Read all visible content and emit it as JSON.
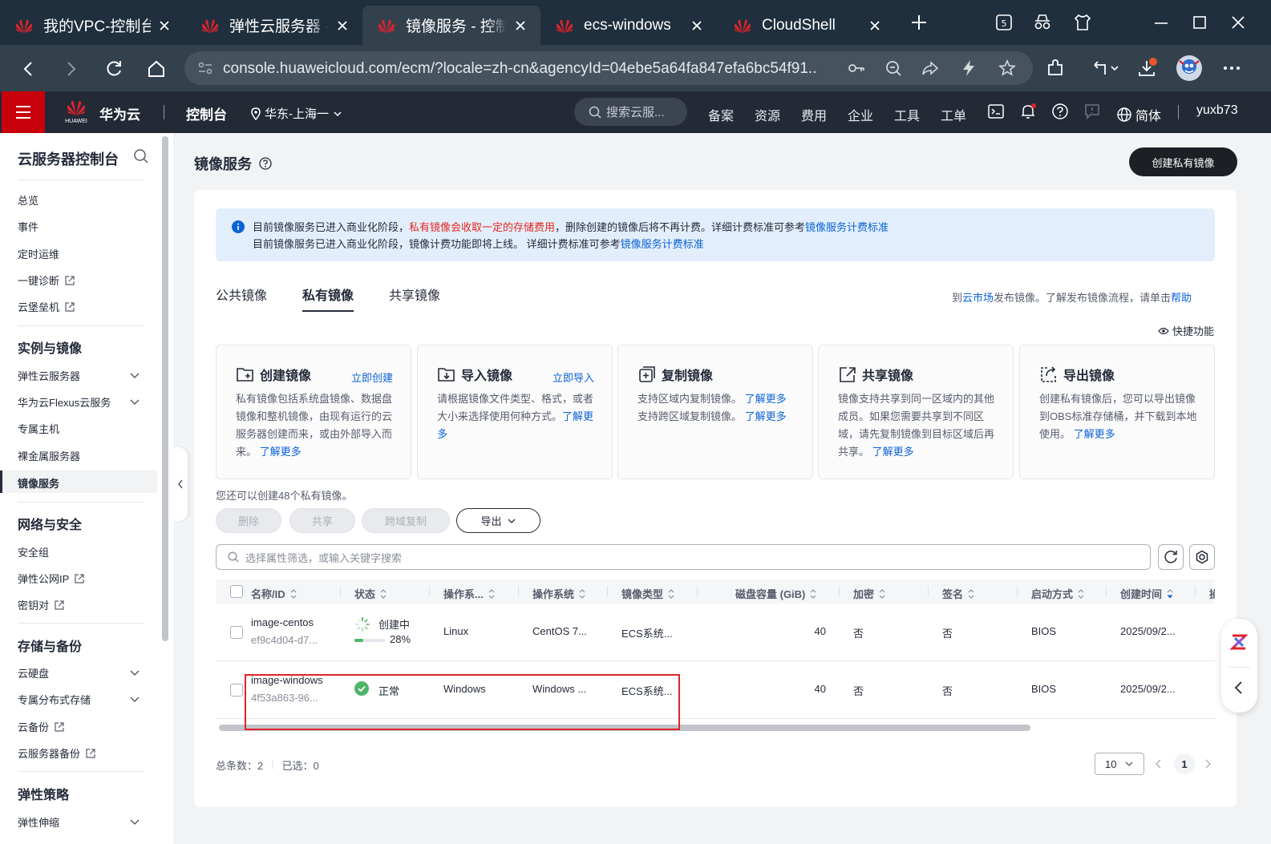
{
  "browser": {
    "tabs": [
      {
        "title": "我的VPC-控制台",
        "active": false
      },
      {
        "title": "弹性云服务器 - 控",
        "active": false
      },
      {
        "title": "镜像服务 - 控制台",
        "active": true
      },
      {
        "title": "ecs-windows",
        "active": false
      },
      {
        "title": "CloudShell",
        "active": false
      }
    ],
    "new_tab_icon": "plus-icon",
    "url": "console.huaweicloud.com/ecm/?locale=zh-cn&agencyId=04ebe5a64fa847efa6bc54f91..."
  },
  "console_header": {
    "logo_text": "HUAWEI",
    "brand": "华为云",
    "console_label": "控制台",
    "region": "华东-上海一",
    "search_placeholder": "搜索云服...",
    "nav": [
      "备案",
      "资源",
      "费用",
      "企业",
      "工具",
      "工单"
    ],
    "language": "简体",
    "user": "yuxb73"
  },
  "sidebar": {
    "title": "云服务器控制台",
    "top_items": [
      {
        "label": "总览",
        "external": false
      },
      {
        "label": "事件",
        "external": false
      },
      {
        "label": "定时运维",
        "external": false
      },
      {
        "label": "一键诊断",
        "external": true
      },
      {
        "label": "云堡垒机",
        "external": true
      }
    ],
    "groups": [
      {
        "title": "实例与镜像",
        "items": [
          {
            "label": "弹性云服务器",
            "expandable": true
          },
          {
            "label": "华为云Flexus云服务",
            "expandable": true
          },
          {
            "label": "专属主机"
          },
          {
            "label": "裸金属服务器"
          },
          {
            "label": "镜像服务",
            "active": true
          }
        ]
      },
      {
        "title": "网络与安全",
        "items": [
          {
            "label": "安全组"
          },
          {
            "label": "弹性公网IP",
            "external": true
          },
          {
            "label": "密钥对",
            "external": true
          }
        ]
      },
      {
        "title": "存储与备份",
        "items": [
          {
            "label": "云硬盘",
            "expandable": true
          },
          {
            "label": "专属分布式存储",
            "expandable": true
          },
          {
            "label": "云备份",
            "external": true
          },
          {
            "label": "云服务器备份",
            "external": true
          }
        ]
      },
      {
        "title": "弹性策略",
        "items": [
          {
            "label": "弹性伸缩",
            "expandable": true
          }
        ]
      }
    ]
  },
  "main": {
    "title": "镜像服务",
    "create_button": "创建私有镜像",
    "notice": {
      "line1_a": "目前镜像服务已进入商业化阶段，",
      "line1_red": "私有镜像会收取一定的存储费用",
      "line1_b": "，删除创建的镜像后将不再计费。详细计费标准可参考",
      "line1_link": "镜像服务计费标准",
      "line2_a": "目前镜像服务已进入商业化阶段，镜像计费功能即将上线。 详细计费标准可参考",
      "line2_link": "镜像服务计费标准"
    },
    "tabs": [
      {
        "label": "公共镜像",
        "active": false
      },
      {
        "label": "私有镜像",
        "active": true
      },
      {
        "label": "共享镜像",
        "active": false
      }
    ],
    "tabs_right": {
      "a": "到",
      "link1": "云市场",
      "b": "发布镜像。了解发布镜像流程，请单击",
      "link2": "帮助"
    },
    "quick_features": "快捷功能",
    "feature_cards": [
      {
        "title": "创建镜像",
        "action": "立即创建",
        "desc": "私有镜像包括系统盘镜像、数据盘镜像和整机镜像，由现有运行的云服务器创建而来，或由外部导入而来。",
        "more": "了解更多",
        "icon": "folder-add-icon"
      },
      {
        "title": "导入镜像",
        "action": "立即导入",
        "desc": "请根据镜像文件类型、格式，或者大小来选择使用何种方式。",
        "more": "了解更多",
        "icon": "folder-import-icon"
      },
      {
        "title": "复制镜像",
        "action": "",
        "desc": "",
        "lines": [
          {
            "text": "支持区域内复制镜像。",
            "more": "了解更多"
          },
          {
            "text": "支持跨区域复制镜像。",
            "more": "了解更多"
          }
        ],
        "icon": "copy-plus-icon"
      },
      {
        "title": "共享镜像",
        "action": "",
        "desc": "镜像支持共享到同一区域内的其他成员。如果您需要共享到不同区域，请先复制镜像到目标区域后再共享。",
        "more": "了解更多",
        "icon": "share-external-icon"
      },
      {
        "title": "导出镜像",
        "action": "",
        "desc": "创建私有镜像后，您可以导出镜像到OBS标准存储桶，并下载到本地使用。",
        "more": "了解更多",
        "icon": "export-icon"
      }
    ],
    "quota_text": "您还可以创建48个私有镜像。",
    "toolbar": {
      "delete": "删除",
      "share": "共享",
      "cross_copy": "跨域复制",
      "export": "导出"
    },
    "filter_placeholder": "选择属性筛选，或输入关键字搜索",
    "table": {
      "columns": [
        "名称/ID",
        "状态",
        "操作系...",
        "操作系统",
        "镜像类型",
        "磁盘容量 (GiB)",
        "加密",
        "签名",
        "启动方式",
        "创建时间",
        "操"
      ],
      "rows": [
        {
          "name": "image-centos",
          "id": "ef9c4d04-d7...",
          "status": "创建中",
          "progress_label": "28%",
          "progress": 0.28,
          "os_type": "Linux",
          "os": "CentOS 7...",
          "image_type": "ECS系统...",
          "disk": "40",
          "encrypted": "否",
          "signed": "否",
          "boot": "BIOS",
          "created": "2025/09/2..."
        },
        {
          "name": "image-windows",
          "id": "4f53a863-96...",
          "status": "正常",
          "os_type": "Windows",
          "os": "Windows ...",
          "image_type": "ECS系统...",
          "disk": "40",
          "encrypted": "否",
          "signed": "否",
          "boot": "BIOS",
          "created": "2025/09/2..."
        }
      ]
    },
    "pagination": {
      "total_label": "总条数：",
      "total": "2",
      "selected_label": "已选：",
      "selected": "0",
      "page_size": "10",
      "page": "1"
    }
  },
  "colors": {
    "brand_red": "#c7000b",
    "link_blue": "#0b62d6",
    "success_green": "#4fb56a",
    "highlight_red": "#e0232b"
  }
}
